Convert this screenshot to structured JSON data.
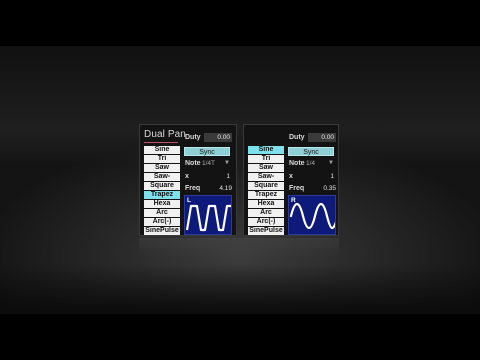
{
  "left": {
    "title": "Dual Pan",
    "waves": [
      "Sine",
      "Tri",
      "Saw",
      "Saw-",
      "Square",
      "Trapez",
      "Hexa",
      "Arc",
      "Arc(-)",
      "SinePulse"
    ],
    "active_wave": "Trapez",
    "duty_label": "Duty",
    "duty_value": "0.00",
    "sync_label": "Sync",
    "note_label": "Note",
    "note_value": "1/4T",
    "x_label": "x",
    "x_value": "1",
    "freq_label": "Freq",
    "freq_value": "4.19",
    "scope_channel": "L"
  },
  "right": {
    "waves": [
      "Sine",
      "Tri",
      "Saw",
      "Saw-",
      "Square",
      "Trapez",
      "Hexa",
      "Arc",
      "Arc(-)",
      "SinePulse"
    ],
    "active_wave": "Sine",
    "duty_label": "Duty",
    "duty_value": "0.00",
    "sync_label": "Sync",
    "note_label": "Note",
    "note_value": "1/4",
    "x_label": "x",
    "x_value": "1",
    "freq_label": "Freq",
    "freq_value": "0.35",
    "scope_channel": "R"
  },
  "colors": {
    "accent_underline": "#c0506a",
    "active_wave": "#7ee0ea",
    "sync_button": "#8fd0d6",
    "scope_bg": "#0e1a7a",
    "scope_wave": "#ffffff"
  },
  "icons": {
    "dropdown": "chevron-down-icon"
  }
}
